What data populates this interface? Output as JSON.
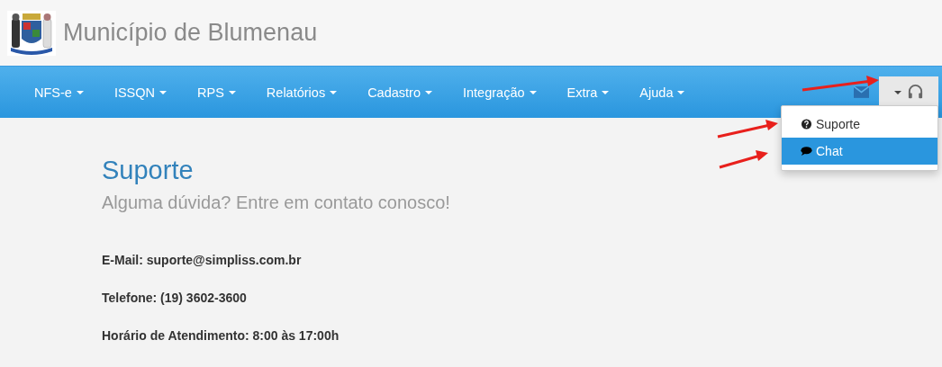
{
  "header": {
    "title": "Município de Blumenau"
  },
  "nav": {
    "items": [
      {
        "label": "NFS-e"
      },
      {
        "label": "ISSQN"
      },
      {
        "label": "RPS"
      },
      {
        "label": "Relatórios"
      },
      {
        "label": "Cadastro"
      },
      {
        "label": "Integração"
      },
      {
        "label": "Extra"
      },
      {
        "label": "Ajuda"
      }
    ],
    "support_menu": {
      "expanded": true,
      "items": [
        {
          "label": "Suporte",
          "kind": "question",
          "selected": false
        },
        {
          "label": "Chat",
          "kind": "chat",
          "selected": true
        }
      ]
    }
  },
  "content": {
    "title": "Suporte",
    "subtitle": "Alguma dúvida? Entre em contato conosco!",
    "lines": [
      "**E-Mail: suporte@simpliss.com.br**",
      "**Telefone: (19) 3602-3600**",
      "**Horário de Atendimento: 8:00 às 17:00h**"
    ]
  }
}
